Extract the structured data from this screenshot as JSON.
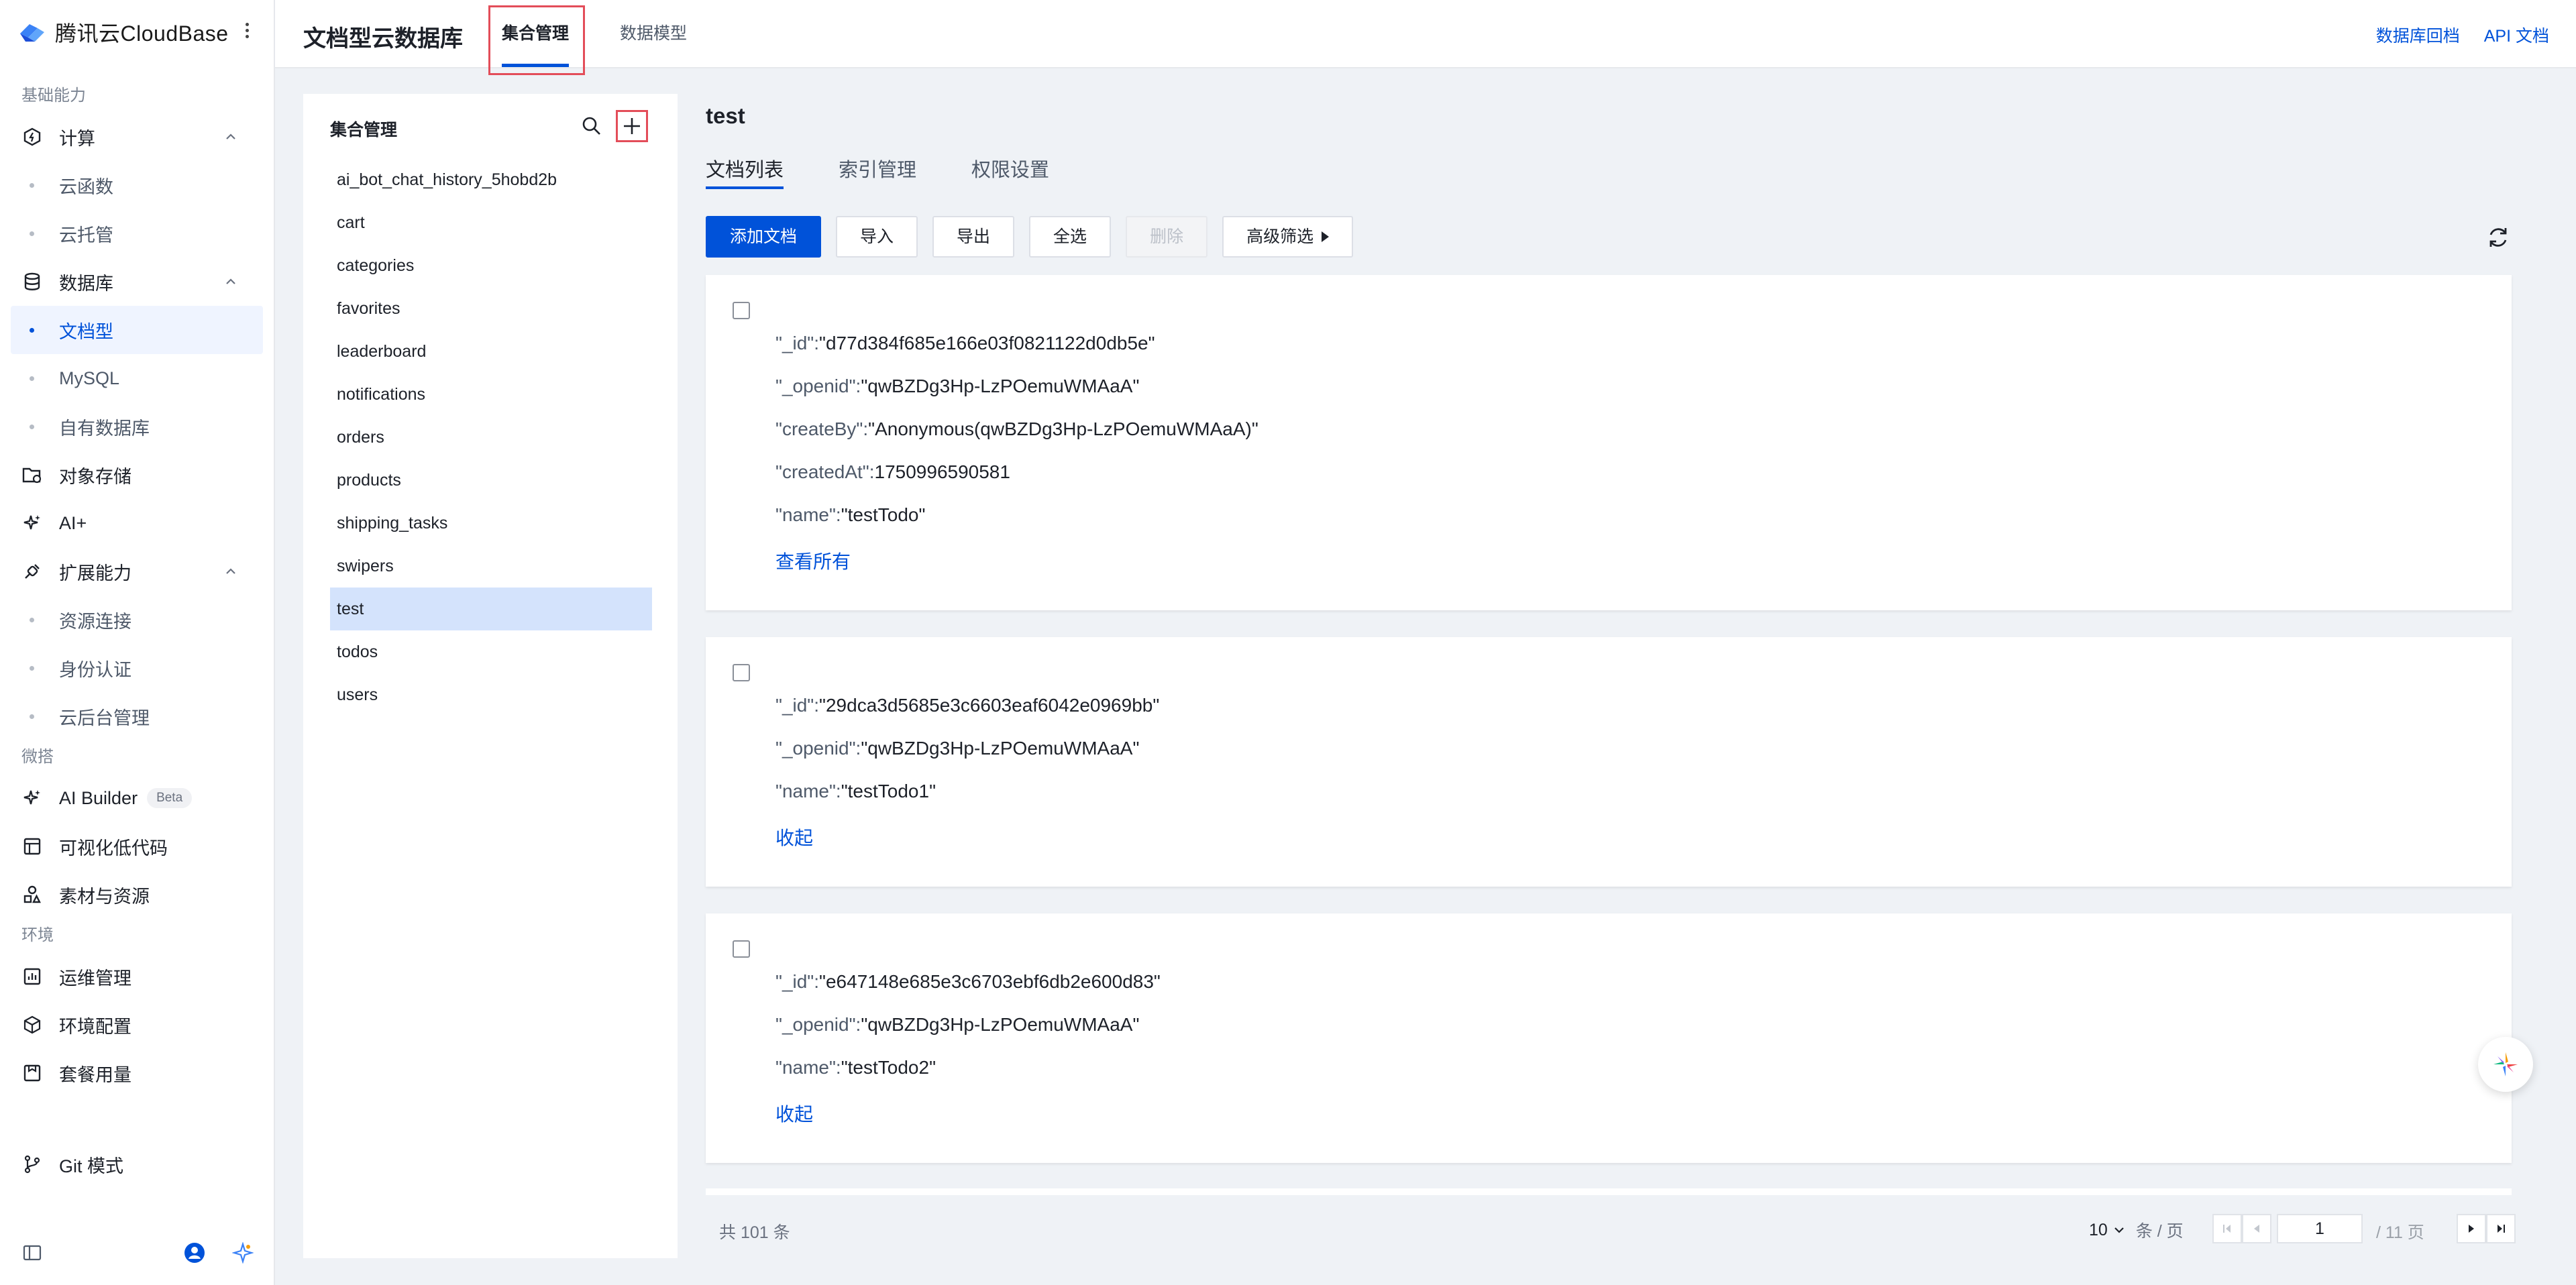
{
  "brand": {
    "name": "腾讯云CloudBase"
  },
  "sidebar": {
    "section_basic": "基础能力",
    "compute": {
      "label": "计算",
      "items": [
        "云函数",
        "云托管"
      ]
    },
    "database": {
      "label": "数据库",
      "items": [
        "文档型",
        "MySQL",
        "自有数据库"
      ]
    },
    "storage": "对象存储",
    "ai": "AI+",
    "extensions": {
      "label": "扩展能力",
      "items": [
        "资源连接",
        "身份认证",
        "云后台管理"
      ]
    },
    "section_weida": "微搭",
    "ai_builder": "AI Builder",
    "beta": "Beta",
    "lowcode": "可视化低代码",
    "materials": "素材与资源",
    "section_env": "环境",
    "ops": "运维管理",
    "env_config": "环境配置",
    "usage": "套餐用量",
    "git": "Git 模式"
  },
  "header": {
    "title": "文档型云数据库",
    "tabs": [
      "集合管理",
      "数据模型"
    ],
    "links": [
      "数据库回档",
      "API 文档"
    ]
  },
  "collections": {
    "title": "集合管理",
    "items": [
      "ai_bot_chat_history_5hobd2b",
      "cart",
      "categories",
      "favorites",
      "leaderboard",
      "notifications",
      "orders",
      "products",
      "shipping_tasks",
      "swipers",
      "test",
      "todos",
      "users"
    ],
    "selected": "test"
  },
  "main": {
    "collection_name": "test",
    "tabs": [
      "文档列表",
      "索引管理",
      "权限设置"
    ],
    "toolbar": {
      "add": "添加文档",
      "import": "导入",
      "export": "导出",
      "select_all": "全选",
      "delete": "删除",
      "filter": "高级筛选"
    }
  },
  "documents": [
    {
      "fields": [
        {
          "k": "\"_id\":",
          "v": "\"d77d384f685e166e03f0821122d0db5e\""
        },
        {
          "k": "\"_openid\":",
          "v": "\"qwBZDg3Hp-LzPOemuWMAaA\""
        },
        {
          "k": "\"createBy\":",
          "v": "\"Anonymous(qwBZDg3Hp-LzPOemuWMAaA)\""
        },
        {
          "k": "\"createdAt\":",
          "v": "1750996590581"
        },
        {
          "k": "\"name\":",
          "v": "\"testTodo\""
        }
      ],
      "link": "查看所有"
    },
    {
      "fields": [
        {
          "k": "\"_id\":",
          "v": "\"29dca3d5685e3c6603eaf6042e0969bb\""
        },
        {
          "k": "\"_openid\":",
          "v": "\"qwBZDg3Hp-LzPOemuWMAaA\""
        },
        {
          "k": "\"name\":",
          "v": "\"testTodo1\""
        }
      ],
      "link": "收起"
    },
    {
      "fields": [
        {
          "k": "\"_id\":",
          "v": "\"e647148e685e3c6703ebf6db2e600d83\""
        },
        {
          "k": "\"_openid\":",
          "v": "\"qwBZDg3Hp-LzPOemuWMAaA\""
        },
        {
          "k": "\"name\":",
          "v": "\"testTodo2\""
        }
      ],
      "link": "收起"
    }
  ],
  "pagination": {
    "total": "共 101 条",
    "page_size": "10",
    "page_size_unit": "条 / 页",
    "current_page": "1",
    "total_pages": "/ 11 页"
  },
  "colors": {
    "accent": "#0052d9",
    "selected_bg": "#d4e3fc",
    "highlight_box": "#e34d59"
  }
}
